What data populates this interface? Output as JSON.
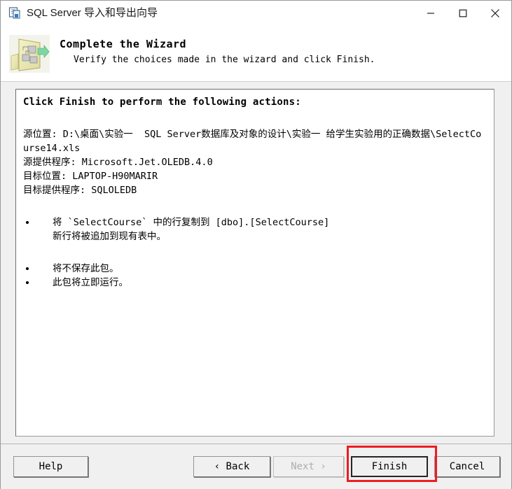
{
  "window": {
    "title": "SQL Server 导入和导出向导",
    "icon": "wizard-document-icon",
    "caption_buttons": {
      "minimize": "minimize-icon",
      "maximize": "maximize-icon",
      "close": "close-icon"
    }
  },
  "banner": {
    "icon": "package-arrow-icon",
    "title": "Complete the Wizard",
    "subtitle": "Verify the choices made in the wizard and click Finish."
  },
  "content": {
    "heading": "Click Finish to perform the following actions:",
    "info_lines": [
      "源位置: D:\\桌面\\实验一  SQL Server数据库及对象的设计\\实验一 给学生实验用的正确数据\\SelectCourse14.xls",
      "源提供程序: Microsoft.Jet.OLEDB.4.0",
      "目标位置: LAPTOP-H90MARIR",
      "目标提供程序: SQLOLEDB"
    ],
    "bullet_group_1": [
      {
        "line1": "将 `SelectCourse` 中的行复制到 [dbo].[SelectCourse]",
        "line2": "新行将被追加到现有表中。"
      }
    ],
    "bullet_group_2": [
      {
        "line1": "将不保存此包。",
        "line2": ""
      },
      {
        "line1": "此包将立即运行。",
        "line2": ""
      }
    ]
  },
  "footer": {
    "help": "Help",
    "back": "‹ Back",
    "next": "Next ›",
    "finish": "Finish",
    "cancel": "Cancel"
  },
  "annotation": {
    "highlight_color": "#ee1c24",
    "highlight_target": "finish-button"
  }
}
